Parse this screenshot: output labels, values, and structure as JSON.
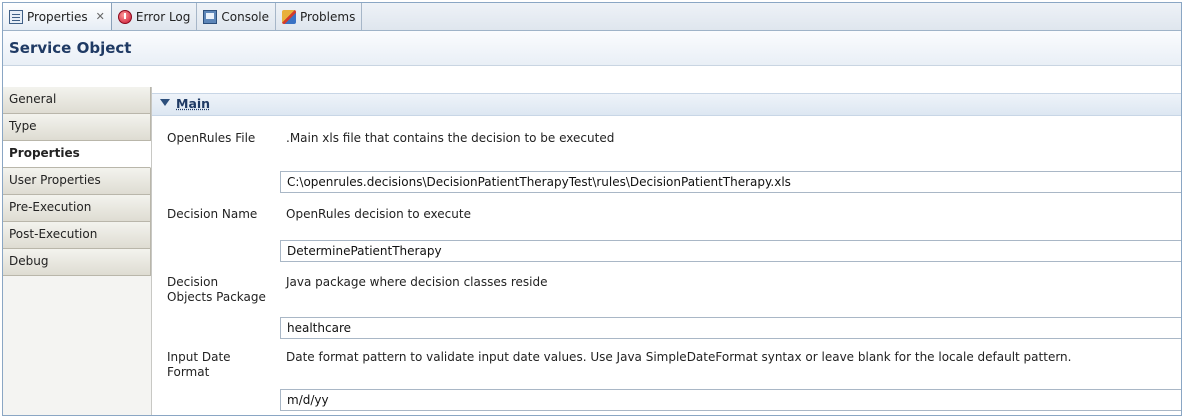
{
  "tabs": [
    {
      "label": "Properties",
      "icon": "properties-icon",
      "active": true
    },
    {
      "label": "Error Log",
      "icon": "error-log-icon"
    },
    {
      "label": "Console",
      "icon": "console-icon"
    },
    {
      "label": "Problems",
      "icon": "problems-icon"
    }
  ],
  "close_glyph": "✕",
  "header": {
    "title": "Service Object"
  },
  "nav": [
    {
      "label": "General"
    },
    {
      "label": "Type"
    },
    {
      "label": "Properties",
      "active": true
    },
    {
      "label": "User Properties"
    },
    {
      "label": "Pre-Execution"
    },
    {
      "label": "Post-Execution"
    },
    {
      "label": "Debug"
    }
  ],
  "section": {
    "title": "Main"
  },
  "fields": [
    {
      "label": "OpenRules File",
      "description": ".Main xls file that contains the decision to be executed",
      "value": "C:\\openrules.decisions\\DecisionPatientTherapyTest\\rules\\DecisionPatientTherapy.xls"
    },
    {
      "label": "Decision Name",
      "description": "OpenRules decision to execute",
      "value": "DeterminePatientTherapy"
    },
    {
      "label": "Decision Objects Package",
      "description": "Java package where decision classes reside",
      "value": "healthcare"
    },
    {
      "label": "Input Date Format",
      "description": "Date format pattern to validate input date values.  Use Java SimpleDateFormat syntax or leave blank for the locale default pattern.",
      "value": "m/d/yy"
    }
  ]
}
